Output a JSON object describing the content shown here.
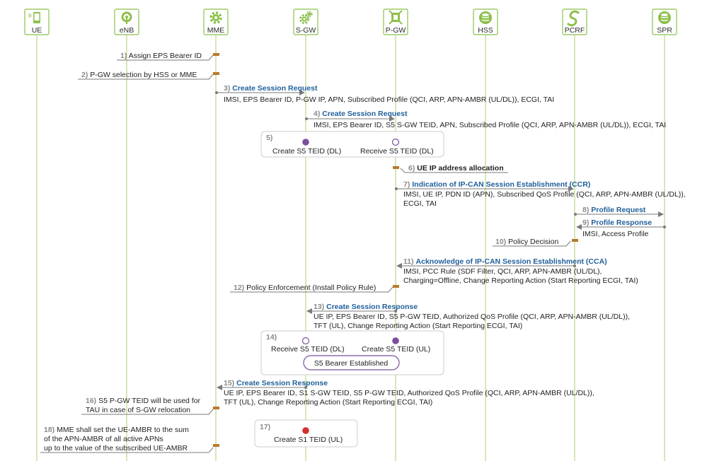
{
  "colors": {
    "lifeline": "#b7d98a",
    "entity_border": "#8cc04b",
    "entity_fill": "#8cc04b",
    "arrow": "#7a7a7a",
    "marker": "#b77b2a",
    "title_blue": "#1f5f9a",
    "teid_purple": "#7b4f9e",
    "teid_red": "#d32f2f",
    "box_border": "#cccccc"
  },
  "entities": [
    {
      "name": "UE",
      "icon": "mobile-phone-icon"
    },
    {
      "name": "eNB",
      "icon": "antenna-icon"
    },
    {
      "name": "MME",
      "icon": "gear-icon"
    },
    {
      "name": "S-GW",
      "icon": "gears-icon"
    },
    {
      "name": "P-GW",
      "icon": "gateway-icon"
    },
    {
      "name": "HSS",
      "icon": "database-icon"
    },
    {
      "name": "PCRF",
      "icon": "policy-icon"
    },
    {
      "name": "SPR",
      "icon": "database-icon"
    }
  ],
  "steps": {
    "s1": {
      "num": "1)",
      "text": "Assign EPS Bearer ID"
    },
    "s2": {
      "num": "2)",
      "text": "P-GW selection by HSS or MME"
    },
    "s3": {
      "num": "3)",
      "title": "Create Session Request",
      "detail": "IMSI, EPS Bearer ID, P-GW IP, APN, Subscribed Profile (QCI, ARP, APN-AMBR (UL/DL)), ECGI, TAI"
    },
    "s4": {
      "num": "4)",
      "title": "Create Session Request",
      "detail": "IMSI, EPS Bearer ID, S5 S-GW TEID, APN, Subscribed Profile (QCI, ARP, APN-AMBR (UL/DL)), ECGI, TAI"
    },
    "s5": {
      "num": "5)",
      "left": "Create S5 TEID (DL)",
      "right": "Receive S5 TEID (DL)"
    },
    "s6": {
      "num": "6)",
      "text": "UE IP address allocation"
    },
    "s7": {
      "num": "7)",
      "title": "Indication of IP-CAN Session Establishment (CCR)",
      "detail1": "IMSI, UE IP, PDN ID (APN), Subscribed QoS Profile (QCI, ARP, APN-AMBR (UL/DL)),",
      "detail2": "ECGI, TAI"
    },
    "s8": {
      "num": "8)",
      "title": "Profile Request"
    },
    "s9": {
      "num": "9)",
      "title": "Profile Response",
      "detail": "IMSI, Access Profile"
    },
    "s10": {
      "num": "10)",
      "text": "Policy Decision"
    },
    "s11": {
      "num": "11)",
      "title": "Acknowledge of IP-CAN Session Establishment (CCA)",
      "detail1": "IMSI, PCC Rule (SDF Filter, QCI, ARP, APN-AMBR (UL/DL),",
      "detail2": "Charging=Offline, Change Reporting Action (Start Reporting ECGI, TAI)"
    },
    "s12": {
      "num": "12)",
      "text": "Policy Enforcement (Install Policy Rule)"
    },
    "s13": {
      "num": "13)",
      "title": "Create Session Response",
      "detail1": "UE IP, EPS Bearer ID, S5 P-GW TEID, Authorized QoS Profile (QCI, ARP, APN-AMBR (UL/DL)),",
      "detail2": "TFT (UL), Change Reporting Action (Start Reporting ECGI, TAI)"
    },
    "s14": {
      "num": "14)",
      "left": "Receive S5 TEID (DL)",
      "right": "Create S5 TEID (UL)",
      "bearer": "S5 Bearer Established"
    },
    "s15": {
      "num": "15)",
      "title": "Create Session Response",
      "detail1": "UE IP, EPS Bearer ID, S1 S-GW TEID, S5 P-GW TEID, Authorized QoS Profile (QCI, ARP, APN-AMBR (UL/DL)),",
      "detail2": "TFT (UL), Change Reporting Action (Start Reporting ECGI, TAI)"
    },
    "s16": {
      "num": "16)",
      "line1": "S5 P-GW TEID will be used for",
      "line2": "TAU in case of S-GW relocation"
    },
    "s17": {
      "num": "17)",
      "text": "Create S1 TEID (UL)"
    },
    "s18": {
      "num": "18)",
      "line1": "MME shall set the UE-AMBR to the sum",
      "line2": "of the APN-AMBR of all active APNs",
      "line3": "up to the value of the subscribed UE-AMBR"
    }
  }
}
